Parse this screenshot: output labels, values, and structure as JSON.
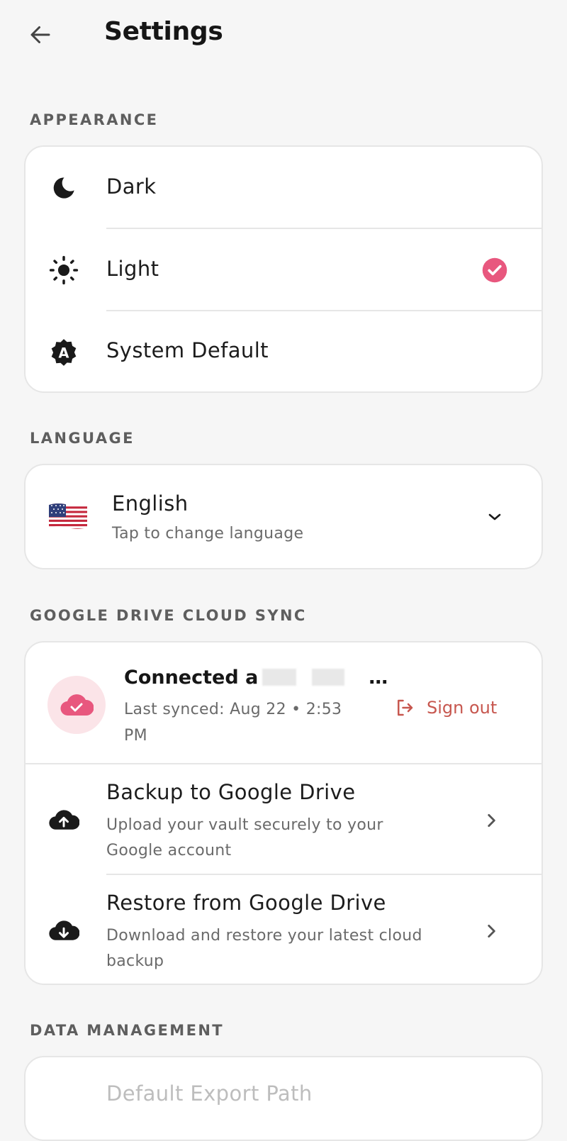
{
  "header": {
    "title": "Settings"
  },
  "appearance": {
    "section_label": "APPEARANCE",
    "options": [
      {
        "label": "Dark",
        "icon": "moon-icon",
        "selected": false
      },
      {
        "label": "Light",
        "icon": "sun-icon",
        "selected": true
      },
      {
        "label": "System Default",
        "icon": "auto-theme-icon",
        "selected": false
      }
    ]
  },
  "language": {
    "section_label": "LANGUAGE",
    "current": "English",
    "hint": "Tap to change language",
    "flag_icon": "us-flag-icon"
  },
  "cloud_sync": {
    "section_label": "GOOGLE DRIVE CLOUD SYNC",
    "status_prefix": "Connected a",
    "status_suffix": "…",
    "last_synced": "Last synced: Aug 22 • 2:53 PM",
    "sign_out": "Sign out",
    "actions": [
      {
        "title": "Backup to Google Drive",
        "subtitle": "Upload your vault securely to your Google account",
        "icon": "cloud-upload-icon"
      },
      {
        "title": "Restore from Google Drive",
        "subtitle": "Download and restore your latest cloud backup",
        "icon": "cloud-download-icon"
      }
    ]
  },
  "data_management": {
    "section_label": "DATA MANAGEMENT",
    "first_item": "Default Export Path"
  },
  "colors": {
    "accent": "#e8577e",
    "sign_out": "#c7574f",
    "cloud_bg": "#fbe4e8"
  }
}
